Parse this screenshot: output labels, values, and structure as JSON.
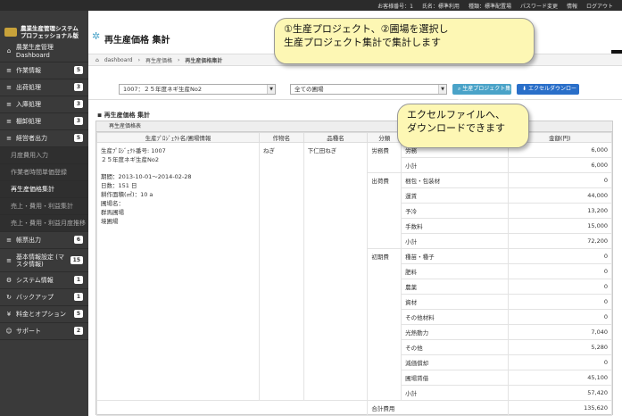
{
  "app": {
    "title_line1": "農業生産管理システム",
    "title_line2": "プロフェッショナル版"
  },
  "topnav": [
    "お客様番号：1",
    "氏名：標準利用",
    "種類：標準配置場",
    "パスワード変更",
    "情報",
    "ログアウト"
  ],
  "sidebar": {
    "items": [
      {
        "label": "農業生産管理 Dashboard",
        "badge": ""
      },
      {
        "label": "作業情報",
        "badge": "5"
      },
      {
        "label": "出荷処理",
        "badge": "3"
      },
      {
        "label": "入庫処理",
        "badge": "3"
      },
      {
        "label": "棚卸処理",
        "badge": "3"
      },
      {
        "label": "経営者出力",
        "badge": "5"
      },
      {
        "label": "月度費用入力",
        "badge": "",
        "sub": true
      },
      {
        "label": "作業者時間単価登録",
        "badge": "",
        "sub": true
      },
      {
        "label": "再生産価格集計",
        "badge": "",
        "sub": true,
        "active": true
      },
      {
        "label": "売上・費用・利益集計",
        "badge": "",
        "sub": true
      },
      {
        "label": "売上・費用・利益月度推移",
        "badge": "",
        "sub": true
      },
      {
        "label": "帳票出力",
        "badge": "6"
      },
      {
        "label": "基本情報設定 (マスタ情報)",
        "badge": "15"
      },
      {
        "label": "システム情報",
        "badge": "1"
      },
      {
        "label": "バックアップ",
        "badge": "1"
      },
      {
        "label": "料金とオプション",
        "badge": "5"
      },
      {
        "label": "サポート",
        "badge": "2"
      }
    ]
  },
  "page": {
    "title": "再生産価格 集計"
  },
  "breadcrumb": [
    "dashboard",
    "再生産価格",
    "再生産価格集計"
  ],
  "filters": {
    "project": "1007：２５年度ネギ生産No2",
    "field": "全ての圃場",
    "aggregate_button": "生産プロジェクト集計",
    "export_button": "エクセルダウンロード"
  },
  "section_title": "再生産価格 集計",
  "panel_title": "再生産価格表",
  "table": {
    "headers": [
      "生産ﾌﾟﾛｼﾞｪｸﾄ名/圃場情報",
      "作物名",
      "品種名",
      "分類",
      "金額(円)"
    ],
    "project_info": [
      "生産ﾌﾟﾛｼﾞｪｸﾄ番号: 1007",
      "２５年度ネギ生産No2",
      "",
      "期間：2013-10-01～2014-02-28",
      "日数：151 日",
      "耕作面積(㎡)：10 a",
      "圃場名：",
      "群馬圃場",
      "境圃場"
    ],
    "crop": "ねぎ",
    "variety": "下仁田ねぎ",
    "groups": [
      {
        "category": "労務費",
        "rows": [
          {
            "item": "労務",
            "amount": "6,000"
          },
          {
            "item": "小計",
            "amount": "6,000"
          }
        ]
      },
      {
        "category": "出荷費",
        "rows": [
          {
            "item": "梱包・包装材",
            "amount": "0"
          },
          {
            "item": "運賃",
            "amount": "44,000"
          },
          {
            "item": "予冷",
            "amount": "13,200"
          },
          {
            "item": "手数料",
            "amount": "15,000"
          },
          {
            "item": "小計",
            "amount": "72,200"
          }
        ]
      },
      {
        "category": "初期費",
        "rows": [
          {
            "item": "種苗・種子",
            "amount": "0"
          },
          {
            "item": "肥料",
            "amount": "0"
          },
          {
            "item": "農薬",
            "amount": "0"
          },
          {
            "item": "資材",
            "amount": "0"
          },
          {
            "item": "その他材料",
            "amount": "0"
          },
          {
            "item": "光熱動力",
            "amount": "7,040"
          },
          {
            "item": "その他",
            "amount": "5,280"
          },
          {
            "item": "減価償却",
            "amount": "0"
          },
          {
            "item": "圃場賃借",
            "amount": "45,100"
          },
          {
            "item": "小計",
            "amount": "57,420"
          }
        ]
      }
    ],
    "total_label": "合計費用",
    "total_amount": "135,620"
  },
  "callouts": {
    "top": [
      "①生産プロジェクト、②圃場を選択し",
      "生産プロジェクト集計で集計します"
    ],
    "right": [
      "エクセルファイルへ、",
      "ダウンロードできます"
    ]
  },
  "colors": {
    "sidebar": "#3a3a3a",
    "aggregate_button": "#4aa3c8",
    "export_button": "#2a6fc9",
    "callout": "#fdf7b4"
  }
}
